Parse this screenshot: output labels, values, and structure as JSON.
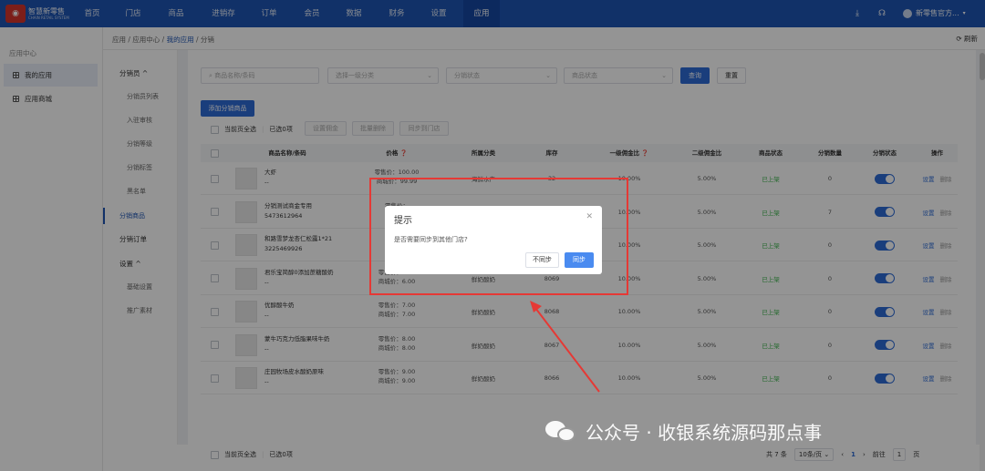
{
  "brand": {
    "name_line1": "智慧新零售",
    "name_line2": "CHAIN RETAIL SYSTEM"
  },
  "topnav": {
    "items": [
      "首页",
      "门店",
      "商品",
      "进销存",
      "订单",
      "会员",
      "数据",
      "财务",
      "设置",
      "应用"
    ],
    "active": "应用",
    "user_name": "新零售官方..."
  },
  "sidebar": {
    "title": "应用中心",
    "items": [
      {
        "label": "我的应用",
        "active": true
      },
      {
        "label": "应用商城",
        "active": false
      }
    ]
  },
  "breadcrumb": {
    "part1": "应用",
    "part2": "应用中心",
    "part3": "我的应用",
    "part4": "分销",
    "refresh_label": "刷新"
  },
  "subnav": {
    "group1": "分销员 ^",
    "items1": [
      "分销员列表",
      "入驻审核",
      "分销等级",
      "分销标签",
      "黑名单"
    ],
    "active": "分销商品",
    "group2": "分销订单",
    "group3": "设置 ^",
    "items3": [
      "基础设置",
      "推广素材"
    ]
  },
  "filters": {
    "search_placeholder": "商品名称/条码",
    "category_placeholder": "选择一级分类",
    "distribution_status_placeholder": "分销状态",
    "product_status_placeholder": "商品状态",
    "query_label": "查询",
    "reset_label": "重置"
  },
  "actions": {
    "add_label": "添加分销商品",
    "select_page_label": "当前页全选",
    "selected_count_label": "已选0项",
    "set_commission_label": "设置佣金",
    "batch_delete_label": "批量删除",
    "sync_store_label": "同步到门店"
  },
  "table": {
    "headers": [
      "商品名称/条码",
      "价格 ❓",
      "所属分类",
      "库存",
      "一级佣金比 ❓",
      "二级佣金比",
      "商品状态",
      "分销数量",
      "分销状态",
      "操作"
    ],
    "rows": [
      {
        "name": "大虾",
        "code": "--",
        "retail": "零售价：100.00",
        "mall": "商城价：99.99",
        "category": "海鲜水产",
        "stock": "32",
        "c1": "10.00%",
        "c2": "5.00%",
        "status": "已上架",
        "qty": "0",
        "edit": "设置",
        "del": "删除"
      },
      {
        "name": "分销测试商金专用",
        "code": "5473612964",
        "retail": "零售价：",
        "mall": "商城价：",
        "category": "",
        "stock": "",
        "c1": "10.00%",
        "c2": "5.00%",
        "status": "已上架",
        "qty": "7",
        "edit": "设置",
        "del": "删除"
      },
      {
        "name": "和路雪梦龙杏仁松露1*21",
        "code": "3225469926",
        "retail": "零售价：",
        "mall": "商城价：",
        "category": "",
        "stock": "",
        "c1": "10.00%",
        "c2": "5.00%",
        "status": "已上架",
        "qty": "0",
        "edit": "设置",
        "del": "删除"
      },
      {
        "name": "君乐宝简醇0添加蔗糖酸奶",
        "code": "--",
        "retail": "零售价：6.00",
        "mall": "商城价：6.00",
        "category": "鲜奶酸奶",
        "stock": "8069",
        "c1": "10.00%",
        "c2": "5.00%",
        "status": "已上架",
        "qty": "0",
        "edit": "设置",
        "del": "删除"
      },
      {
        "name": "优醇酸牛奶",
        "code": "--",
        "retail": "零售价：7.00",
        "mall": "商城价：7.00",
        "category": "鲜奶酸奶",
        "stock": "8068",
        "c1": "10.00%",
        "c2": "5.00%",
        "status": "已上架",
        "qty": "0",
        "edit": "设置",
        "del": "删除"
      },
      {
        "name": "蒙牛巧克力低脂果味牛奶",
        "code": "--",
        "retail": "零售价：8.00",
        "mall": "商城价：8.00",
        "category": "鲜奶酸奶",
        "stock": "8067",
        "c1": "10.00%",
        "c2": "5.00%",
        "status": "已上架",
        "qty": "0",
        "edit": "设置",
        "del": "删除"
      },
      {
        "name": "庄园牧场皮水酸奶原味",
        "code": "--",
        "retail": "零售价：9.00",
        "mall": "商城价：9.00",
        "category": "鲜奶酸奶",
        "stock": "8066",
        "c1": "10.00%",
        "c2": "5.00%",
        "status": "已上架",
        "qty": "0",
        "edit": "设置",
        "del": "删除"
      }
    ]
  },
  "footer": {
    "select_page_label": "当前页全选",
    "selected_count_label": "已选0项",
    "total_label": "共 7 条",
    "page_size": "10条/页",
    "current_page": "1",
    "goto_label": "前往",
    "goto_value": "1",
    "page_unit": "页"
  },
  "dialog": {
    "title": "提示",
    "message": "是否需要同步到其他门店?",
    "cancel_label": "不同步",
    "confirm_label": "同步"
  },
  "watermark": {
    "text": "公众号 · 收银系统源码那点事"
  },
  "colors": {
    "topbar": "#1e55b4",
    "primary": "#2d6bd6",
    "highlight": "#e53935",
    "status_up": "#3bb34a"
  }
}
